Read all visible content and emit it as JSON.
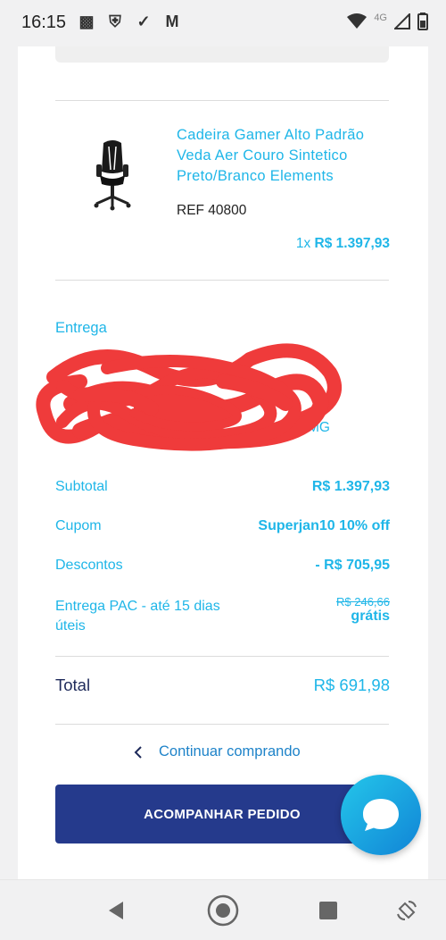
{
  "status_bar": {
    "time": "16:15",
    "network": "4G",
    "left_icons": [
      "notification-app-icon",
      "shield-icon",
      "check-badge-icon",
      "gmail-icon"
    ],
    "right_icons": [
      "wifi-icon",
      "signal-icon",
      "battery-icon"
    ]
  },
  "product": {
    "name": "Cadeira Gamer Alto Padrão Veda Aer Couro Sintetico Preto/Branco Elements",
    "ref": "REF 40800",
    "quantity": "1x",
    "price": "R$ 1.397,93"
  },
  "delivery": {
    "title": "Entrega",
    "line_partial": "nhi/MG"
  },
  "summary": {
    "subtotal_label": "Subtotal",
    "subtotal_value": "R$ 1.397,93",
    "coupon_label": "Cupom",
    "coupon_value": "Superjan10 10% off",
    "discount_label": "Descontos",
    "discount_value": "- R$ 705,95",
    "shipping_label": "Entrega PAC - até 15 dias úteis",
    "shipping_original": "R$ 246,66",
    "shipping_value": "grátis"
  },
  "total": {
    "label": "Total",
    "value": "R$ 691,98"
  },
  "actions": {
    "continue_label": "Continuar comprando",
    "primary_label": "ACOMPANHAR PEDIDO"
  },
  "colors": {
    "accent": "#1fb6e8",
    "button": "#253a8c",
    "total_label": "#1e2a5a",
    "redaction": "#ef3b3b"
  }
}
